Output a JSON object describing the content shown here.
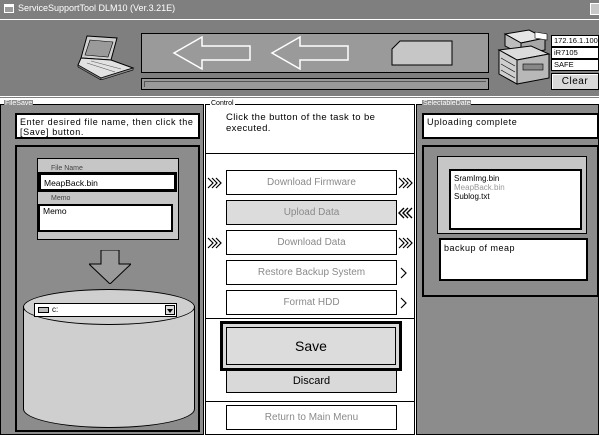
{
  "window": {
    "title": "ServiceSupportTool DLM10 (Ver.3.21E)"
  },
  "device": {
    "ip": "172.16.1.100",
    "model": "iR7105",
    "mode": "SAFE",
    "clear_label": "Clear",
    "transfer_direction": "device-to-pc"
  },
  "file_save": {
    "legend": "FileSave",
    "message": "Enter desired file name, then click the [Save] button.",
    "file_name_label": "File Name",
    "file_name_value": "MeapBack.bin",
    "memo_label": "Memo",
    "memo_value": "Memo",
    "drive_value": "c:"
  },
  "control": {
    "legend": "Control",
    "message": "Click the button of the task to be executed.",
    "buttons": [
      {
        "label": "Download Firmware",
        "state": "enabled"
      },
      {
        "label": "Upload Data",
        "state": "selected"
      },
      {
        "label": "Download Data",
        "state": "enabled"
      },
      {
        "label": "Restore Backup System",
        "state": "enabled"
      },
      {
        "label": "Format HDD",
        "state": "enabled"
      }
    ],
    "save_label": "Save",
    "discard_label": "Discard",
    "return_label": "Return to Main Menu"
  },
  "selectable_date": {
    "legend": "SelectableDate",
    "message": "Uploading complete",
    "files": [
      "SramImg.bin",
      "MeapBack.bin",
      "Sublog.txt"
    ],
    "selected_file": "MeapBack.bin",
    "memo_text": "backup of meap"
  },
  "icons": {
    "window": "window-icon",
    "laptop": "laptop-icon",
    "printer": "printer-icon",
    "arrow": "left-arrow-icon",
    "drive": "drive-icon",
    "down_arrow": "down-arrow-icon",
    "chevron": "chevron-icon"
  },
  "colors": {
    "frame_gray": "#8c8c8c",
    "header_gray": "#7f7f7f",
    "disabled_text": "#8a8a8a"
  }
}
